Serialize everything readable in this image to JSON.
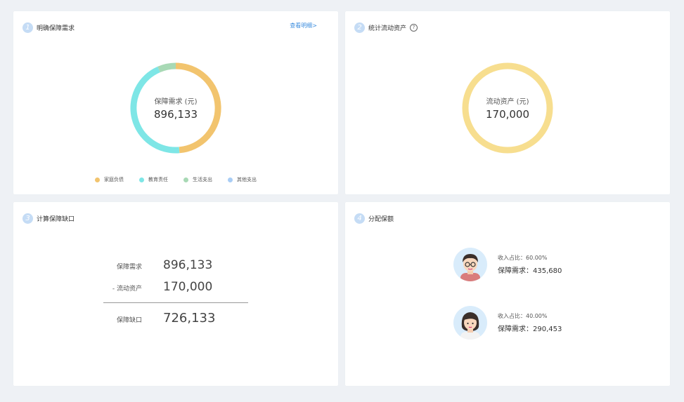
{
  "card1": {
    "step": "1",
    "title": "明确保障需求",
    "link": "查看明细>",
    "donut": {
      "label": "保障需求 (元)",
      "value": "896,133"
    },
    "legend": [
      {
        "label": "家庭负债",
        "color": "#f2c46e"
      },
      {
        "label": "教育责任",
        "color": "#7ee6e6"
      },
      {
        "label": "生活支出",
        "color": "#a8d9b5"
      },
      {
        "label": "其他支出",
        "color": "#a9cdf5"
      }
    ]
  },
  "card2": {
    "step": "2",
    "title": "统计流动资产",
    "help_icon": "question-icon",
    "donut": {
      "label": "流动资产 (元)",
      "value": "170,000",
      "color": "#f7de8f"
    }
  },
  "card3": {
    "step": "3",
    "title": "计算保障缺口",
    "rows": [
      {
        "label": "保障需求",
        "value": "896,133"
      },
      {
        "label": "- 流动资产",
        "value": "170,000"
      },
      {
        "label": "保障缺口",
        "value": "726,133"
      }
    ]
  },
  "card4": {
    "step": "4",
    "title": "分配保额",
    "persons": [
      {
        "ratio": "收入占比：60.00%",
        "need": "保障需求：435,680",
        "avatar": "male-avatar"
      },
      {
        "ratio": "收入占比：40.00%",
        "need": "保障需求：290,453",
        "avatar": "female-avatar"
      }
    ]
  }
}
